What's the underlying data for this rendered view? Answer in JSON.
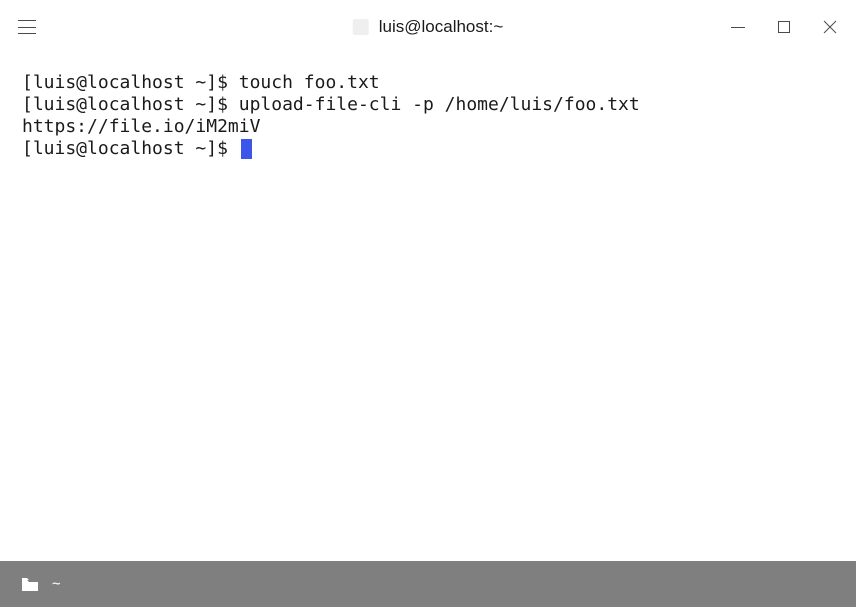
{
  "titlebar": {
    "title": "luis@localhost:~"
  },
  "terminal": {
    "lines": [
      {
        "prompt": "[luis@localhost ~]$ ",
        "command": "touch foo.txt"
      },
      {
        "prompt": "[luis@localhost ~]$ ",
        "command": "upload-file-cli -p /home/luis/foo.txt"
      },
      {
        "output": "https://file.io/iM2miV"
      }
    ],
    "current_prompt": "[luis@localhost ~]$ "
  },
  "footer": {
    "path": "~"
  }
}
